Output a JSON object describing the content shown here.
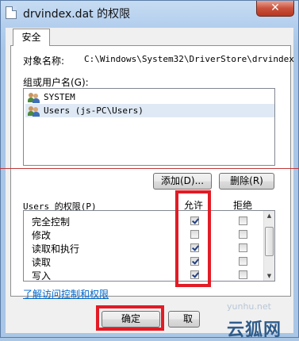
{
  "window": {
    "title": "drvindex.dat 的权限",
    "close_label": "✕"
  },
  "tabs": [
    {
      "label": "安全"
    }
  ],
  "object": {
    "label": "对象名称:",
    "value": "C:\\Windows\\System32\\DriverStore\\drvindex"
  },
  "groups": {
    "label": "组或用户名(G):",
    "items": [
      {
        "name": "SYSTEM",
        "icon": "users-icon"
      },
      {
        "name": "Users (js-PC\\Users)",
        "icon": "users-icon",
        "selected": true
      }
    ],
    "add_label": "添加(D)...",
    "remove_label": "删除(R)"
  },
  "permissions": {
    "label": "Users 的权限(P)",
    "allow_header": "允许",
    "deny_header": "拒绝",
    "rows": [
      {
        "name": "完全控制",
        "allow": true,
        "deny": false
      },
      {
        "name": "修改",
        "allow": false,
        "deny": false
      },
      {
        "name": "读取和执行",
        "allow": true,
        "deny": false
      },
      {
        "name": "读取",
        "allow": true,
        "deny": false
      },
      {
        "name": "写入",
        "allow": true,
        "deny": false
      }
    ]
  },
  "link": {
    "label": "了解访问控制和权限"
  },
  "footer": {
    "ok_label": "确定",
    "cancel_label": "取"
  },
  "watermark": {
    "url": "yunhu.net",
    "text": "云狐网"
  },
  "colors": {
    "highlight": "#e21b25",
    "link": "#0066cc"
  }
}
